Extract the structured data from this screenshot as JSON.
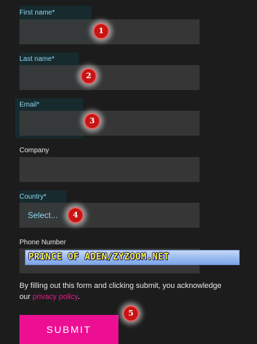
{
  "form": {
    "first_name": {
      "label": "First name*",
      "value": ""
    },
    "last_name": {
      "label": "Last name*",
      "value": ""
    },
    "email": {
      "label": "Email*",
      "value": ""
    },
    "company": {
      "label": "Company",
      "value": ""
    },
    "country": {
      "label": "Country*",
      "selected": "Select..."
    },
    "phone": {
      "label": "Phone Number",
      "value": ""
    }
  },
  "banner": {
    "text": "PRINCE OF ADEN/ZYZOOM.NET"
  },
  "consent": {
    "text_before": "By filling out this form and clicking submit, you acknowledge our",
    "link": "privacy policy",
    "text_after": "."
  },
  "submit": {
    "label": "SUBMIT"
  },
  "markers": [
    "1",
    "2",
    "3",
    "4",
    "5"
  ],
  "colors": {
    "background": "#1c1c1c",
    "required_label": "#8ed6ef",
    "plain_label": "#e8e8e8",
    "field": "#3e3e3e",
    "link": "#e81888",
    "submit": "#ec0f93",
    "marker": "#c91414"
  }
}
